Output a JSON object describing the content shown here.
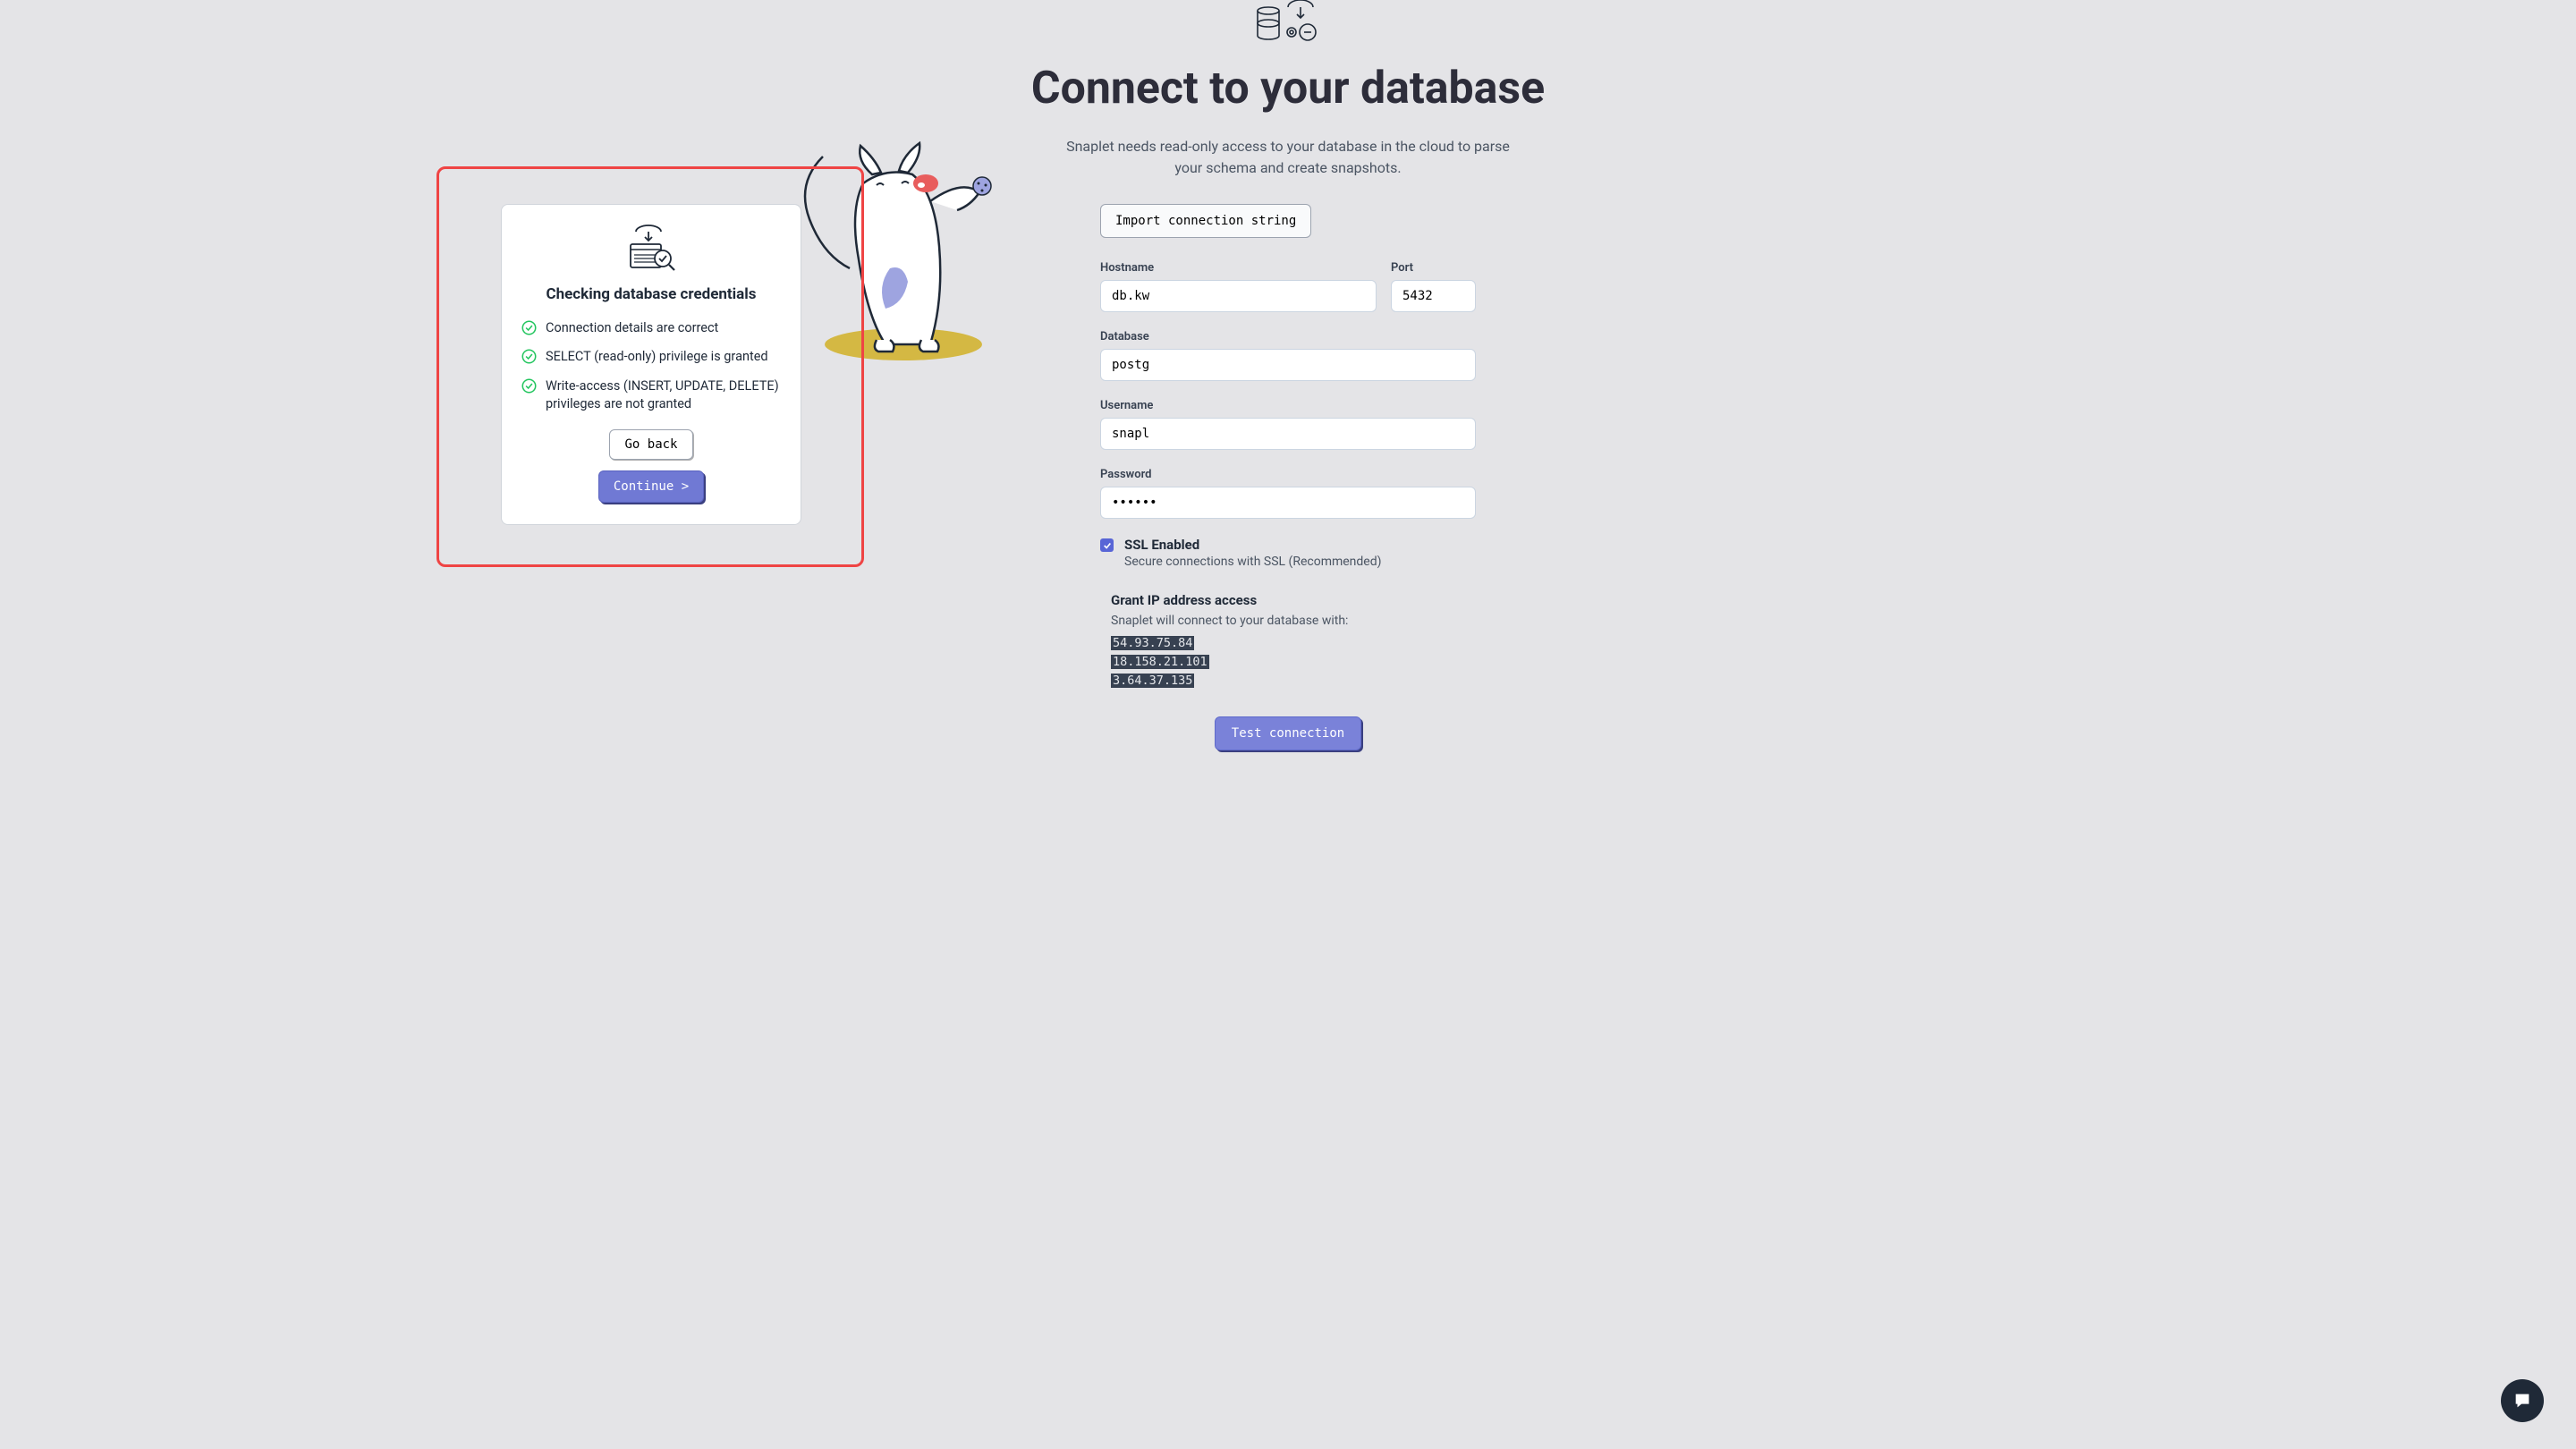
{
  "title": "Connect to your database",
  "subtitle": "Snaplet needs read-only access to your database in the cloud to parse your schema and create snapshots.",
  "import_button": "Import connection string",
  "fields": {
    "hostname_label": "Hostname",
    "hostname_value": "db.kw",
    "port_label": "Port",
    "port_value": "5432",
    "database_label": "Database",
    "database_value": "postg",
    "username_label": "Username",
    "username_value": "snapl",
    "password_label": "Password",
    "password_value": "••••••"
  },
  "ssl": {
    "label": "SSL Enabled",
    "subtext": "Secure connections with SSL (Recommended)"
  },
  "ip_section": {
    "title": "Grant IP address access",
    "subtitle": "Snaplet will connect to your database with:",
    "ips": [
      "54.93.75.84",
      "18.158.21.101",
      "3.64.37.135"
    ]
  },
  "test_button": "Test connection",
  "modal": {
    "title": "Checking database credentials",
    "checks": [
      "Connection details are correct",
      "SELECT (read-only) privilege is granted",
      "Write-access (INSERT, UPDATE, DELETE) privileges are not granted"
    ],
    "go_back": "Go back",
    "continue": "Continue >"
  }
}
